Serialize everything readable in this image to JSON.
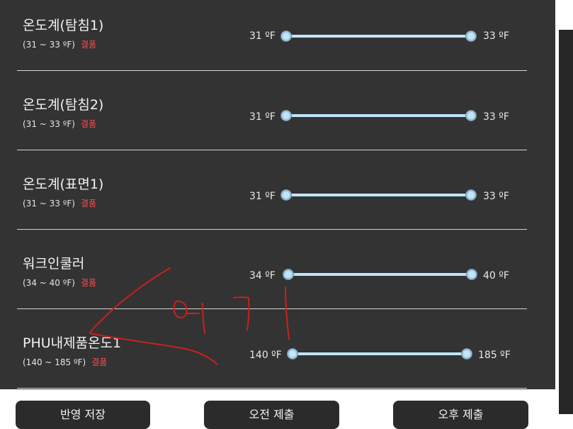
{
  "sensors": [
    {
      "name": "온도계(탐침1)",
      "range": "(31 ~ 33 ºF)",
      "status": "결품",
      "min": "31 ºF",
      "max": "33 ºF"
    },
    {
      "name": "온도계(탐침2)",
      "range": "(31 ~ 33 ºF)",
      "status": "결품",
      "min": "31 ºF",
      "max": "33 ºF"
    },
    {
      "name": "온도계(표면1)",
      "range": "(31 ~ 33 ºF)",
      "status": "결품",
      "min": "31 ºF",
      "max": "33 ºF"
    },
    {
      "name": "워크인쿨러",
      "range": "(34 ~ 40 ºF)",
      "status": "결품",
      "min": "34 ºF",
      "max": "40 ºF"
    },
    {
      "name": "PHU내제품온도1",
      "range": "(140 ~ 185 ºF)",
      "status": "결품",
      "min": "140 ºF",
      "max": "185 ºF"
    }
  ],
  "buttons": [
    {
      "label": "반영 저장"
    },
    {
      "label": "오전 제출"
    },
    {
      "label": "오후 제출"
    }
  ],
  "colors": {
    "panel": "#333333",
    "accent": "#bfe6fb",
    "status": "#ff4d4d",
    "annotation": "#cc1f1f"
  }
}
